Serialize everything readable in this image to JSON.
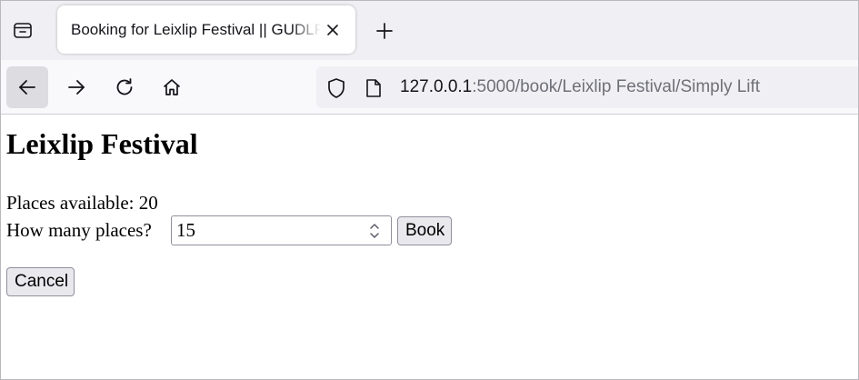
{
  "browser": {
    "tab": {
      "title": "Booking for Leixlip Festival || GUDLFT Registration"
    },
    "url": {
      "host": "127.0.0.1",
      "path": ":5000/book/Leixlip Festival/Simply Lift"
    },
    "icons": {
      "tabs_list": "tabs-list-icon",
      "tab_close": "close-icon",
      "new_tab": "plus-icon",
      "back": "back-arrow-icon",
      "forward": "forward-arrow-icon",
      "reload": "reload-icon",
      "home": "home-icon",
      "shield": "shield-icon",
      "page": "page-icon"
    }
  },
  "page": {
    "title": "Leixlip Festival",
    "places_available": "Places available: 20",
    "quantity_label": "How many places?",
    "quantity_value": "15",
    "book_label": "Book",
    "cancel_label": "Cancel"
  }
}
